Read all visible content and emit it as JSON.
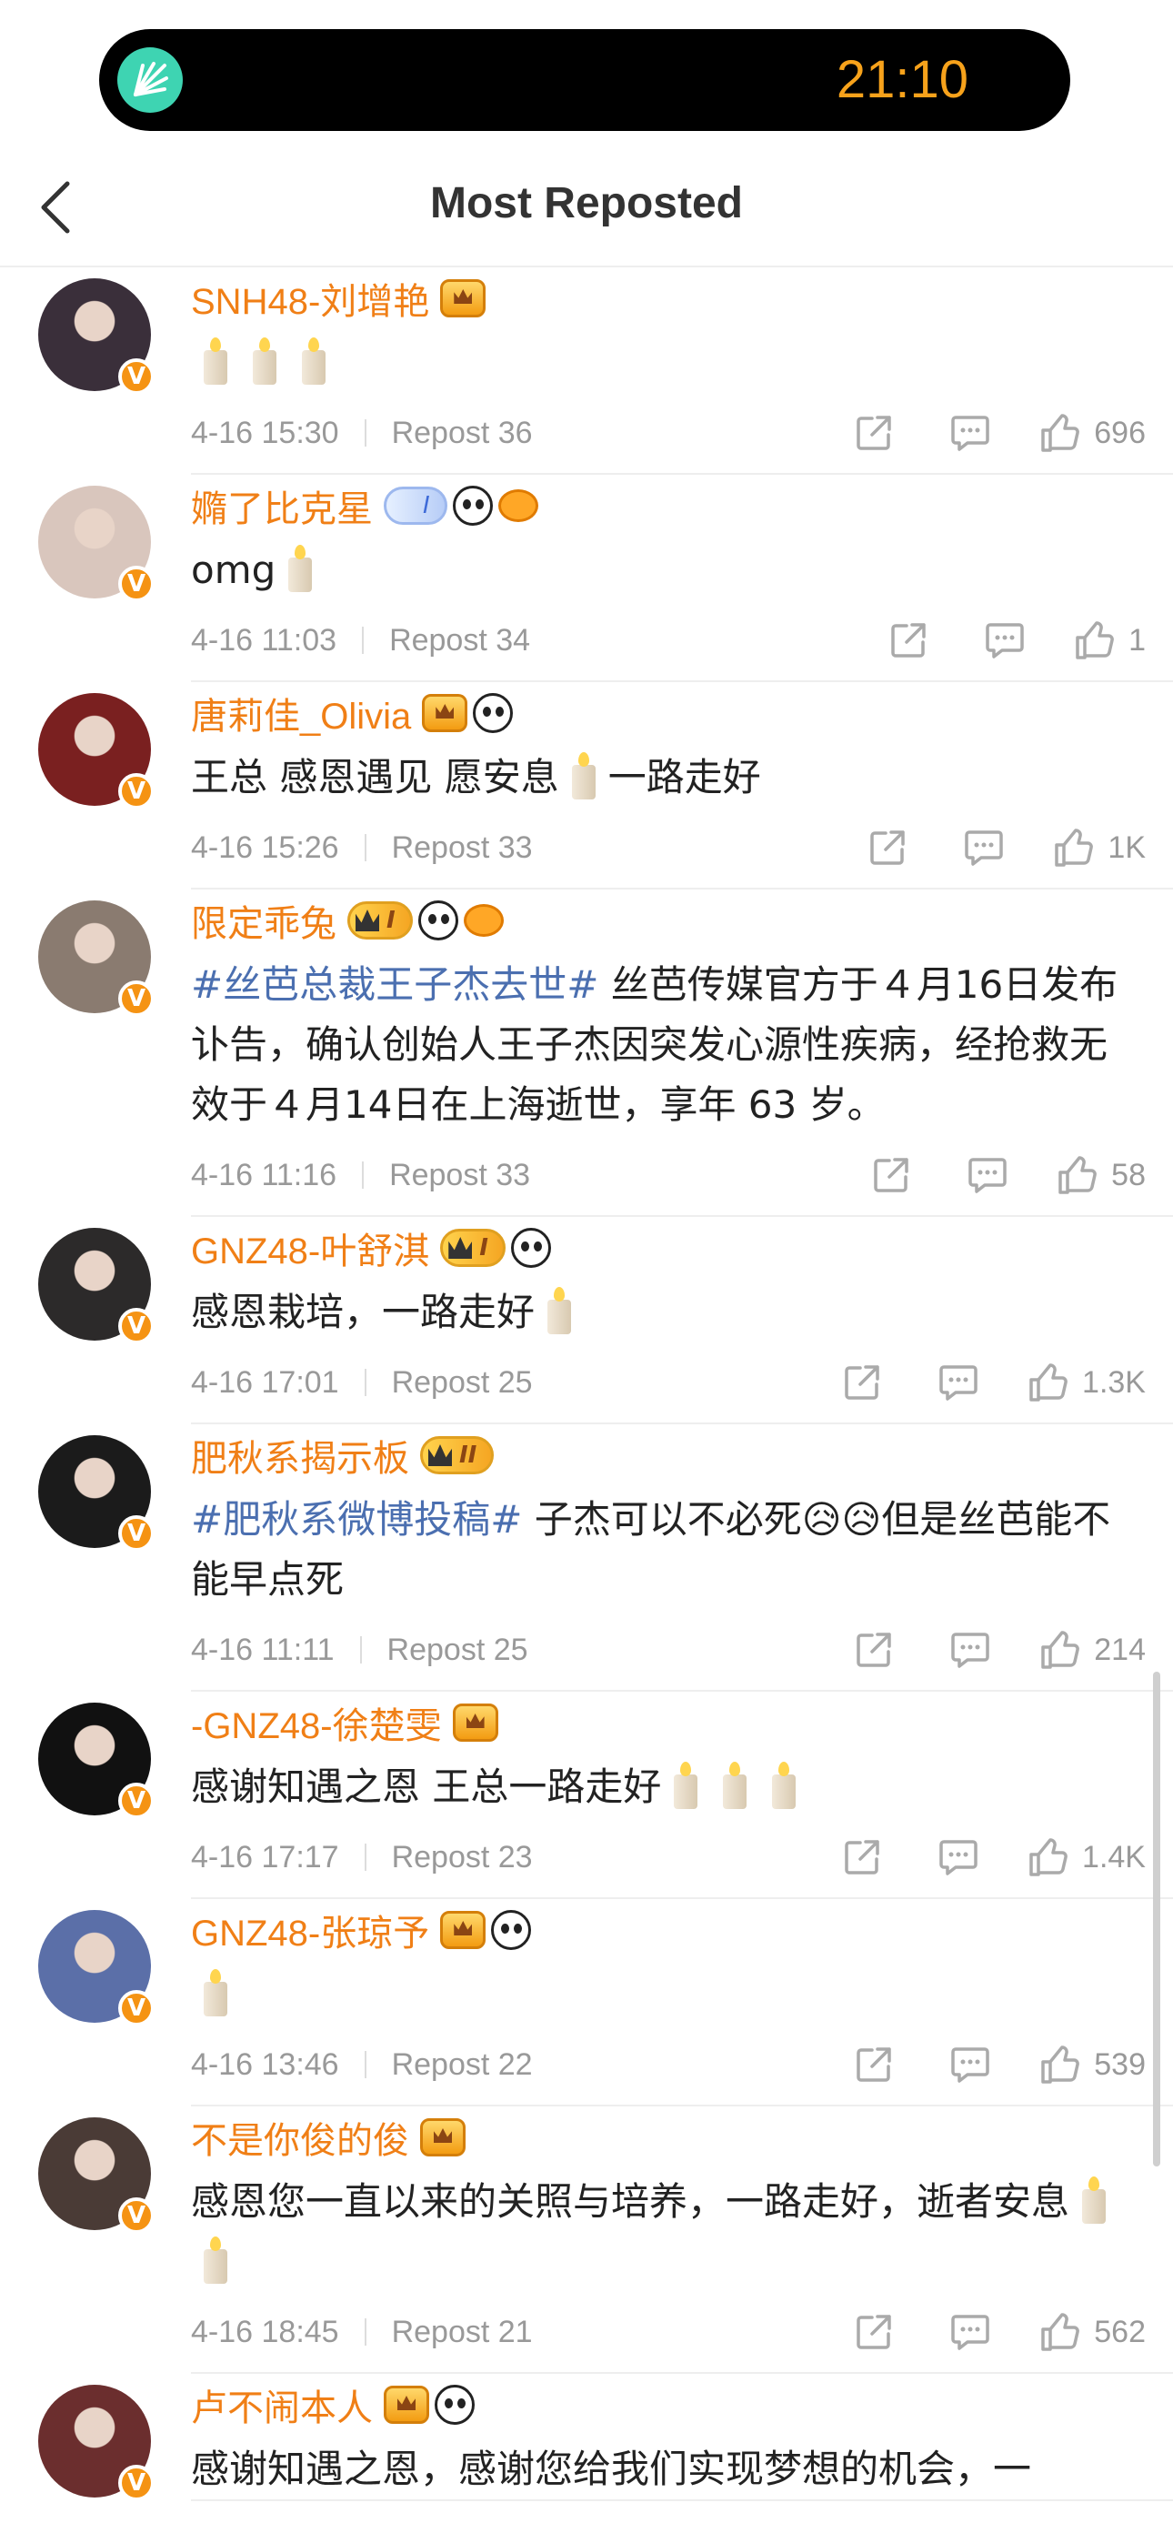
{
  "status_bar": {
    "time": "21:10"
  },
  "header": {
    "title": "Most Reposted"
  },
  "comments": [
    {
      "user": "SNH48-刘增艳",
      "avatar_color": "#3a2f3a",
      "badges": [
        "crown"
      ],
      "text": "",
      "candles": 3,
      "date": "4-16 15:30",
      "repost": "Repost 36",
      "likes": "696"
    },
    {
      "user": "嫷了比克星",
      "avatar_color": "#d9c6bd",
      "badges": [
        "blue",
        "panda",
        "fish"
      ],
      "blue_badge": "I",
      "text": "omg",
      "candles": 1,
      "date": "4-16 11:03",
      "repost": "Repost 34",
      "likes": "1"
    },
    {
      "user": "唐莉佳_Olivia",
      "avatar_color": "#7a2020",
      "badges": [
        "crown",
        "panda"
      ],
      "text": "王总 感恩遇见 愿安息",
      "text_after": "一路走好",
      "candles": 1,
      "date": "4-16 15:26",
      "repost": "Repost 33",
      "likes": "1K"
    },
    {
      "user": "限定乖兔",
      "avatar_color": "#8a7b70",
      "badges": [
        "level",
        "panda",
        "fish"
      ],
      "level_badge": "I",
      "hashtag": "#丝芭总裁王子杰去世#",
      "text": " 丝芭传媒官方于４月16日发布讣告，确认创始人王子杰因突发心源性疾病，经抢救无效于４月14日在上海逝世，享年 63 岁。",
      "candles": 0,
      "date": "4-16 11:16",
      "repost": "Repost 33",
      "likes": "58"
    },
    {
      "user": "GNZ48-叶舒淇",
      "avatar_color": "#2c2a2a",
      "badges": [
        "level",
        "panda"
      ],
      "level_badge": "I",
      "text": "感恩栽培，一路走好",
      "candles": 1,
      "date": "4-16 17:01",
      "repost": "Repost 25",
      "likes": "1.3K"
    },
    {
      "user": "肥秋系揭示板",
      "avatar_color": "#1b1b1b",
      "badges": [
        "level"
      ],
      "level_badge": "II",
      "hashtag": "#肥秋系微博投稿#",
      "text": " 子杰可以不必死😥😥但是丝芭能不能早点死",
      "candles": 0,
      "date": "4-16 11:11",
      "repost": "Repost 25",
      "likes": "214"
    },
    {
      "user": "-GNZ48-徐楚雯",
      "avatar_color": "#111111",
      "badges": [
        "crown"
      ],
      "text": "感谢知遇之恩 王总一路走好",
      "candles": 3,
      "date": "4-16 17:17",
      "repost": "Repost 23",
      "likes": "1.4K"
    },
    {
      "user": "GNZ48-张琼予",
      "avatar_color": "#5b6fa8",
      "badges": [
        "crown",
        "panda"
      ],
      "text": "",
      "candles": 1,
      "date": "4-16 13:46",
      "repost": "Repost 22",
      "likes": "539"
    },
    {
      "user": "不是你俊的俊",
      "avatar_color": "#4a3b36",
      "badges": [
        "crown"
      ],
      "text": "感恩您一直以来的关照与培养，一路走好，逝者安息",
      "candles": 2,
      "date": "4-16 18:45",
      "repost": "Repost 21",
      "likes": "562"
    },
    {
      "user": "卢不闹本人",
      "avatar_color": "#6b2e2e",
      "badges": [
        "crown",
        "panda"
      ],
      "text": "感谢知遇之恩，感谢您给我们实现梦想的机会，一",
      "candles": 0,
      "date": "",
      "repost": "",
      "likes": ""
    }
  ],
  "colors": {
    "username": "#f07f16",
    "hashtag": "#4b6fb0",
    "meta": "#999999",
    "clock": "#f7a21b"
  }
}
